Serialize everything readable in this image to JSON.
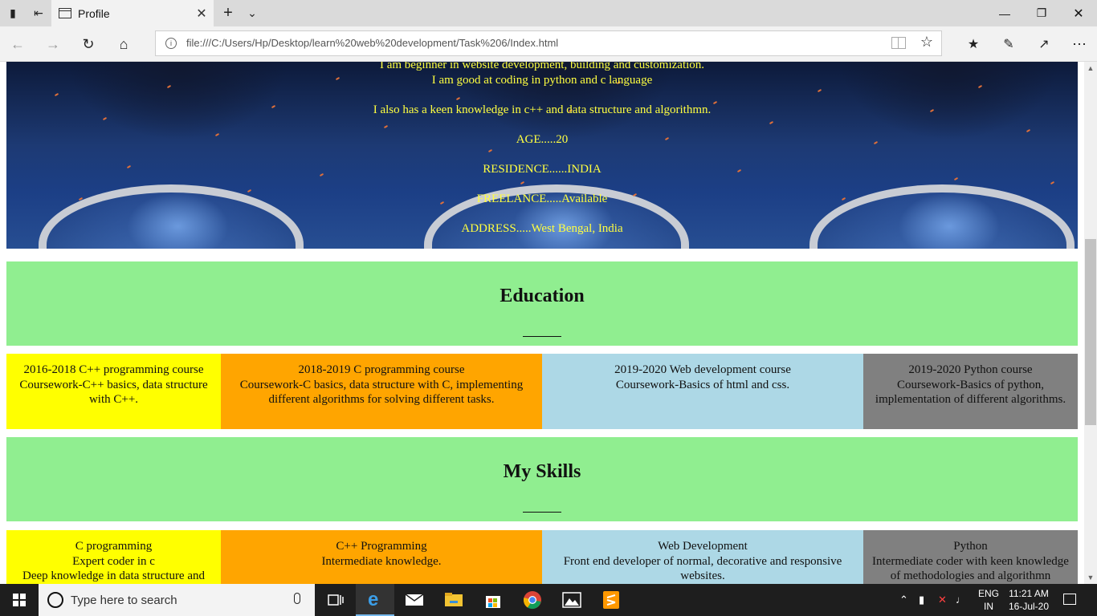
{
  "browser": {
    "tab_title": "Profile",
    "url": "file:///C:/Users/Hp/Desktop/learn%20web%20development/Task%206/Index.html"
  },
  "hero": {
    "lines": [
      "I am beginner in website development, building and customization.",
      "I am good at coding in python and c language",
      "",
      "I also has a keen knowledge in c++ and data structure and algorithmn.",
      "",
      "AGE.....20",
      "",
      "RESIDENCE......INDIA",
      "",
      "FREELANCE.....Available",
      "",
      "ADDRESS.....West Bengal, India"
    ]
  },
  "education": {
    "heading": "Education",
    "cards": [
      {
        "lines": [
          "2016-2018 C++ programming course",
          "Coursework-C++ basics, data structure",
          "with C++."
        ],
        "color": "#ffff00"
      },
      {
        "lines": [
          "2018-2019 C programming course",
          "Coursework-C basics, data structure with C, implementing",
          "different algorithms for solving different tasks."
        ],
        "color": "#ffa500"
      },
      {
        "lines": [
          "2019-2020 Web development course",
          "Coursework-Basics of html and css."
        ],
        "color": "#add8e6"
      },
      {
        "lines": [
          "2019-2020 Python course",
          "Coursework-Basics of python,",
          "implementation of different algorithms."
        ],
        "color": "#808080"
      }
    ]
  },
  "skills": {
    "heading": "My Skills",
    "cards": [
      {
        "lines": [
          "C programming",
          "Expert coder in c",
          "Deep knowledge in data structure and"
        ],
        "color": "#ffff00"
      },
      {
        "lines": [
          "C++ Programming",
          "Intermediate knowledge."
        ],
        "color": "#ffa500"
      },
      {
        "lines": [
          "Web Development",
          "Front end developer of normal, decorative and responsive",
          "websites."
        ],
        "color": "#add8e6"
      },
      {
        "lines": [
          "Python",
          "Intermediate coder with keen knowledge",
          "of methodologies and algorithmn"
        ],
        "color": "#808080"
      }
    ]
  },
  "taskbar": {
    "search_placeholder": "Type here to search",
    "lang_top": "ENG",
    "lang_bottom": "IN",
    "time": "11:21 AM",
    "date": "16-Jul-20"
  }
}
